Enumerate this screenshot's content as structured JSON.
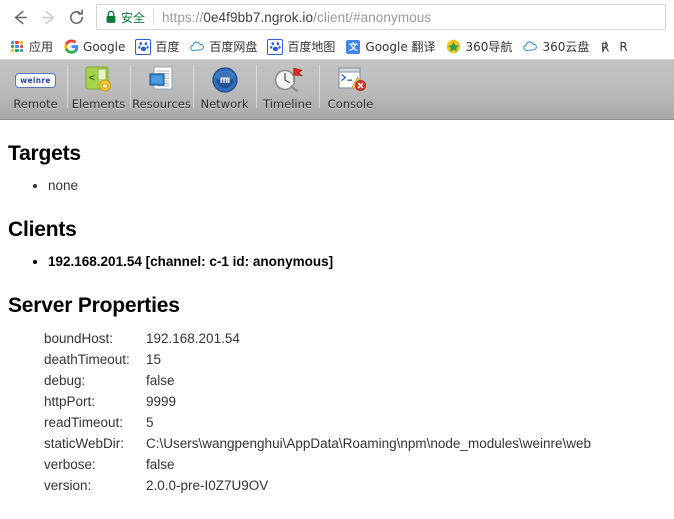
{
  "browser": {
    "nav": {
      "back_icon": "arrow-left-icon",
      "forward_icon": "arrow-right-icon",
      "reload_icon": "reload-icon"
    },
    "omnibox": {
      "lock_icon": "lock-icon",
      "security_label": "安全",
      "url_full": "https://0e4f9bb7.ngrok.io/client/#anonymous",
      "url_scheme": "https://",
      "url_host": "0e4f9bb7.ngrok.io",
      "url_path": "/client/#anonymous"
    },
    "bookmarks": [
      {
        "label": "应用",
        "icon": "apps-grid-icon"
      },
      {
        "label": "Google",
        "icon": "google-g-icon"
      },
      {
        "label": "百度",
        "icon": "baidu-paw-icon"
      },
      {
        "label": "百度网盘",
        "icon": "baidu-pan-icon"
      },
      {
        "label": "百度地图",
        "icon": "baidu-map-icon"
      },
      {
        "label": "Google 翻译",
        "icon": "google-translate-icon"
      },
      {
        "label": "360导航",
        "icon": "360-nav-icon"
      },
      {
        "label": "360云盘",
        "icon": "360-cloud-icon"
      },
      {
        "label": "R",
        "icon": "r-icon"
      }
    ]
  },
  "weinre_toolbar": {
    "items": [
      {
        "label": "Remote",
        "icon": "weinre-logo-icon"
      },
      {
        "label": "Elements",
        "icon": "elements-icon"
      },
      {
        "label": "Resources",
        "icon": "resources-icon"
      },
      {
        "label": "Network",
        "icon": "network-globe-icon"
      },
      {
        "label": "Timeline",
        "icon": "timeline-clock-flag-icon"
      },
      {
        "label": "Console",
        "icon": "console-window-icon"
      }
    ]
  },
  "page": {
    "targets": {
      "title": "Targets",
      "items": [
        "none"
      ]
    },
    "clients": {
      "title": "Clients",
      "items": [
        "192.168.201.54 [channel: c-1 id: anonymous]"
      ]
    },
    "server_properties": {
      "title": "Server Properties",
      "rows": [
        {
          "key": "boundHost:",
          "value": "192.168.201.54"
        },
        {
          "key": "deathTimeout:",
          "value": "15"
        },
        {
          "key": "debug:",
          "value": "false"
        },
        {
          "key": "httpPort:",
          "value": "9999"
        },
        {
          "key": "readTimeout:",
          "value": "5"
        },
        {
          "key": "staticWebDir:",
          "value": "C:\\Users\\wangpenghui\\AppData\\Roaming\\npm\\node_modules\\weinre\\web"
        },
        {
          "key": "verbose:",
          "value": "false"
        },
        {
          "key": "version:",
          "value": "2.0.0-pre-I0Z7U9OV"
        }
      ]
    }
  },
  "colors": {
    "secure_green": "#0b7a37",
    "toolbar_gray": "#bdbdbd",
    "url_host": "#3d3d3d",
    "url_dim": "#9a9a9a"
  }
}
